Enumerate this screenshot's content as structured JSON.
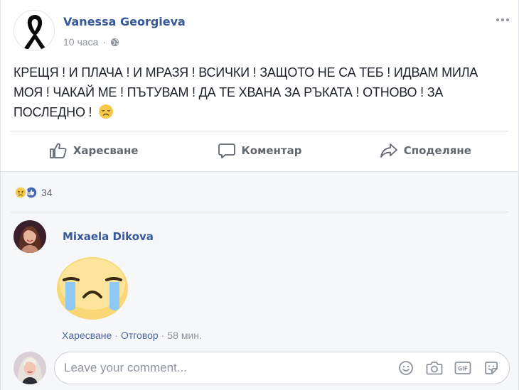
{
  "post": {
    "author": "Vanessa Georgieva",
    "time": "10 часа",
    "separator": "·",
    "text": "КРЕЩЯ ! И ПЛАЧА ! И МРАЗЯ ! ВСИЧКИ ! ЗАЩОТО НЕ СА ТЕБ ! ИДВАМ МИЛА МОЯ ! ЧАКАЙ МЕ ! ПЪТУВАМ ! ДА ТЕ ХВАНА ЗА РЪКАТА ! ОТНОВО ! ЗА ПОСЛЕДНО !"
  },
  "actions": {
    "like": "Харесване",
    "comment": "Коментар",
    "share": "Споделяне"
  },
  "reactions": {
    "icons": [
      "sad-reaction-icon",
      "like-reaction-icon"
    ],
    "count": "34"
  },
  "comment": {
    "author": "Mixaela Dikova",
    "sticker": "crying-face-sticker",
    "like_label": "Харесване",
    "reply_label": "Отговор",
    "dot": "·",
    "time": "58 мин."
  },
  "composer": {
    "placeholder": "Leave your comment...",
    "tools": [
      "emoji-icon",
      "camera-icon",
      "gif-icon",
      "sticker-icon"
    ]
  },
  "colors": {
    "link": "#365899",
    "muted": "#90949c",
    "like_blue": "#4267b2",
    "emoji_yellow": "#f7c94b"
  }
}
